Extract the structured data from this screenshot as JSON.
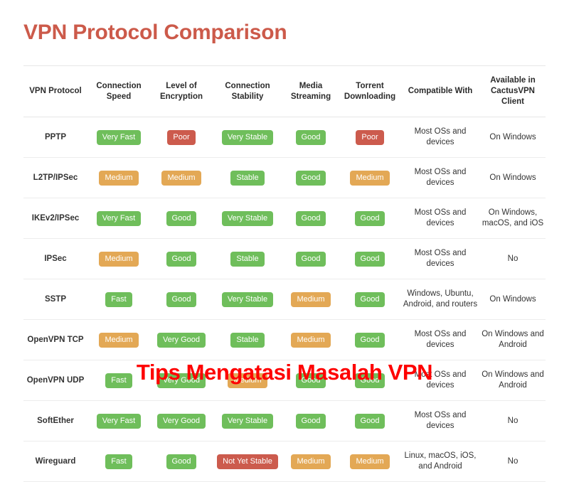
{
  "page": {
    "title": "VPN Protocol Comparison",
    "title_color": "#cc5a4a",
    "background": "#ffffff"
  },
  "watermark": {
    "text": "Tips Mengatasi Masalah VPN",
    "color": "#fe0000"
  },
  "badge_colors": {
    "good": "#6fbe5b",
    "medium": "#e3a855",
    "bad": "#cc5b4d"
  },
  "table": {
    "headers": [
      "VPN Protocol",
      "Connection Speed",
      "Level of Encryption",
      "Connection Stability",
      "Media Streaming",
      "Torrent Downloading",
      "Compatible With",
      "Available in CactusVPN Client"
    ],
    "rows": [
      {
        "protocol": "PPTP",
        "speed": "Very Fast",
        "speed_type": "good",
        "encryption": "Poor",
        "encryption_type": "bad",
        "stability": "Very Stable",
        "stability_type": "good",
        "media": "Good",
        "media_type": "good",
        "torrent": "Poor",
        "torrent_type": "bad",
        "compatible": "Most OSs and devices",
        "available": "On Windows"
      },
      {
        "protocol": "L2TP/IPSec",
        "speed": "Medium",
        "speed_type": "medium",
        "encryption": "Medium",
        "encryption_type": "medium",
        "stability": "Stable",
        "stability_type": "good",
        "media": "Good",
        "media_type": "good",
        "torrent": "Medium",
        "torrent_type": "medium",
        "compatible": "Most OSs and devices",
        "available": "On Windows"
      },
      {
        "protocol": "IKEv2/IPSec",
        "speed": "Very Fast",
        "speed_type": "good",
        "encryption": "Good",
        "encryption_type": "good",
        "stability": "Very Stable",
        "stability_type": "good",
        "media": "Good",
        "media_type": "good",
        "torrent": "Good",
        "torrent_type": "good",
        "compatible": "Most OSs and devices",
        "available": "On Windows, macOS, and iOS"
      },
      {
        "protocol": "IPSec",
        "speed": "Medium",
        "speed_type": "medium",
        "encryption": "Good",
        "encryption_type": "good",
        "stability": "Stable",
        "stability_type": "good",
        "media": "Good",
        "media_type": "good",
        "torrent": "Good",
        "torrent_type": "good",
        "compatible": "Most OSs and devices",
        "available": "No"
      },
      {
        "protocol": "SSTP",
        "speed": "Fast",
        "speed_type": "good",
        "encryption": "Good",
        "encryption_type": "good",
        "stability": "Very Stable",
        "stability_type": "good",
        "media": "Medium",
        "media_type": "medium",
        "torrent": "Good",
        "torrent_type": "good",
        "compatible": "Windows, Ubuntu, Android, and routers",
        "available": "On Windows"
      },
      {
        "protocol": "OpenVPN TCP",
        "speed": "Medium",
        "speed_type": "medium",
        "encryption": "Very Good",
        "encryption_type": "good",
        "stability": "Stable",
        "stability_type": "good",
        "media": "Medium",
        "media_type": "medium",
        "torrent": "Good",
        "torrent_type": "good",
        "compatible": "Most OSs and devices",
        "available": "On Windows and Android"
      },
      {
        "protocol": "OpenVPN UDP",
        "speed": "Fast",
        "speed_type": "good",
        "encryption": "Very Good",
        "encryption_type": "good",
        "stability": "Medium",
        "stability_type": "medium",
        "media": "Good",
        "media_type": "good",
        "torrent": "Good",
        "torrent_type": "good",
        "compatible": "Most OSs and devices",
        "available": "On Windows and Android"
      },
      {
        "protocol": "SoftEther",
        "speed": "Very Fast",
        "speed_type": "good",
        "encryption": "Very Good",
        "encryption_type": "good",
        "stability": "Very Stable",
        "stability_type": "good",
        "media": "Good",
        "media_type": "good",
        "torrent": "Good",
        "torrent_type": "good",
        "compatible": "Most OSs and devices",
        "available": "No"
      },
      {
        "protocol": "Wireguard",
        "speed": "Fast",
        "speed_type": "good",
        "encryption": "Good",
        "encryption_type": "good",
        "stability": "Not Yet Stable",
        "stability_type": "bad",
        "media": "Medium",
        "media_type": "medium",
        "torrent": "Medium",
        "torrent_type": "medium",
        "compatible": "Linux, macOS, iOS, and Android",
        "available": "No"
      }
    ]
  }
}
